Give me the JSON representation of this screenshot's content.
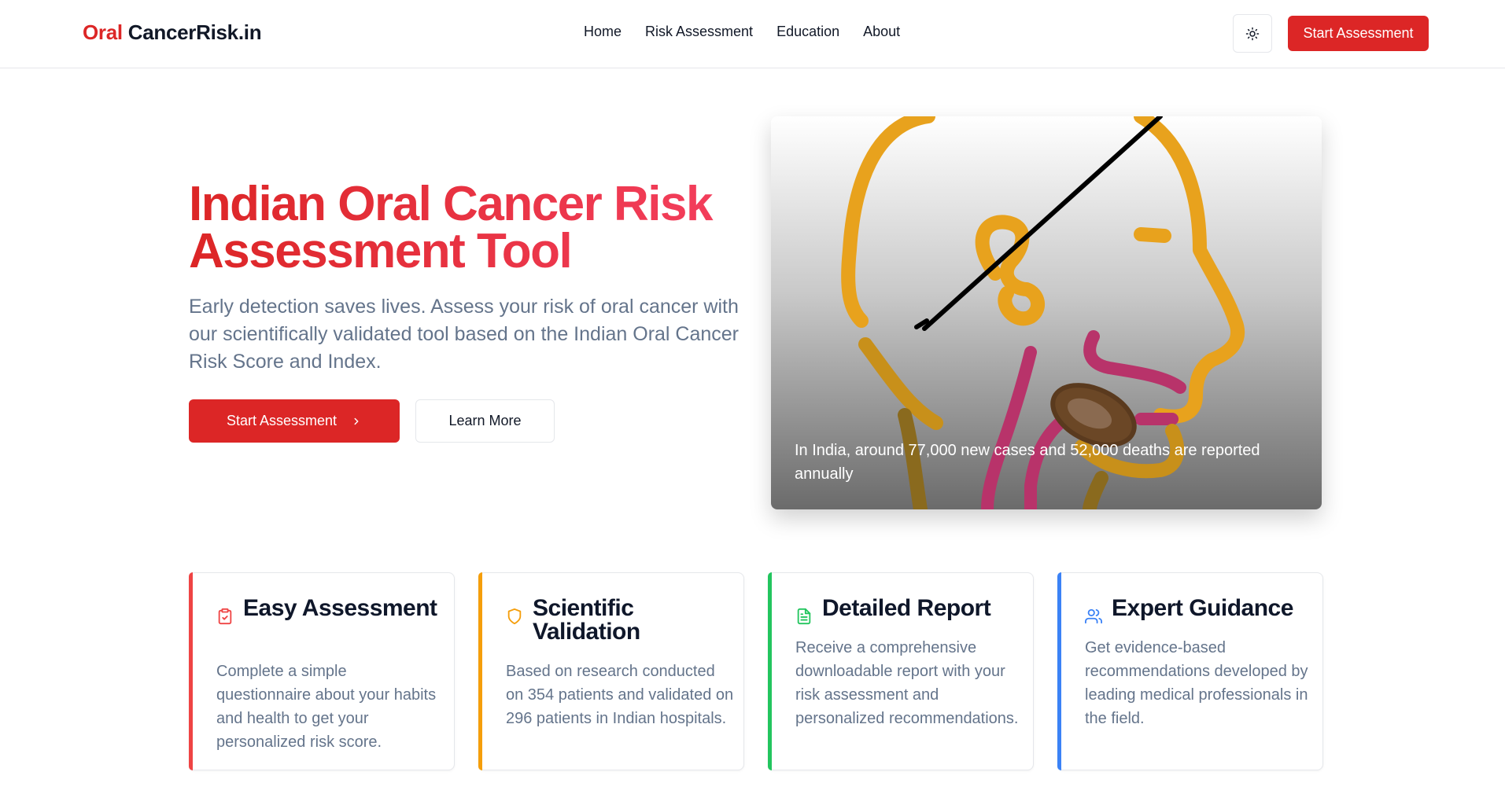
{
  "header": {
    "logo_accent": "Oral",
    "logo_rest": "CancerRisk.in",
    "nav": [
      "Home",
      "Risk Assessment",
      "Education",
      "About"
    ],
    "theme_toggle_icon": "sun-icon",
    "cta_label": "Start Assessment"
  },
  "hero": {
    "title": "Indian Oral Cancer Risk Assessment Tool",
    "subtitle": "Early detection saves lives. Assess your risk of oral cancer with our scientifically validated tool based on the Indian Oral Cancer Risk Score and Index.",
    "primary_button": "Start Assessment",
    "primary_button_icon": "chevron-right-icon",
    "secondary_button": "Learn More",
    "image_caption": "In India, around 77,000 new cases and 52,000 deaths are reported annually"
  },
  "features": [
    {
      "icon": "clipboard-check-icon",
      "title": "Easy Assessment",
      "text": "Complete a simple questionnaire about your habits and health to get your personalized risk score.",
      "color": "#ef4444"
    },
    {
      "icon": "shield-icon",
      "title": "Scientific Validation",
      "text": "Based on research conducted on 354 patients and validated on 296 patients in Indian hospitals.",
      "color": "#f59e0b"
    },
    {
      "icon": "file-text-icon",
      "title": "Detailed Report",
      "text": "Receive a comprehensive downloadable report with your risk assessment and personalized recommendations.",
      "color": "#22c55e"
    },
    {
      "icon": "users-icon",
      "title": "Expert Guidance",
      "text": "Get evidence-based recommendations developed by leading medical professionals in the field.",
      "color": "#3b82f6"
    }
  ],
  "colors": {
    "brand": "#dc2626",
    "muted_text": "#64748b"
  }
}
